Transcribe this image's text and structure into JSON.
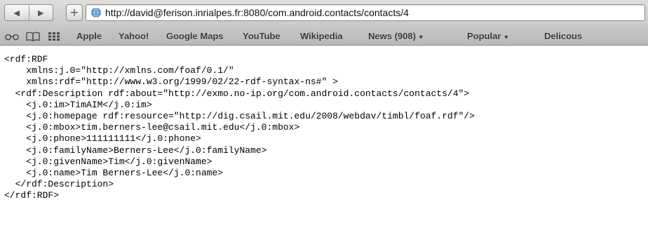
{
  "toolbar": {
    "back_label": "◀",
    "forward_label": "▶",
    "add_label": "+",
    "url": "http://david@ferison.inrialpes.fr:8080/com.android.contacts/contacts/4"
  },
  "bookmarks": {
    "items": [
      {
        "label": "Apple",
        "has_menu": false
      },
      {
        "label": "Yahoo!",
        "has_menu": false
      },
      {
        "label": "Google Maps",
        "has_menu": false
      },
      {
        "label": "YouTube",
        "has_menu": false
      },
      {
        "label": "Wikipedia",
        "has_menu": false
      },
      {
        "label": "News (908)",
        "has_menu": true
      },
      {
        "label": "Popular",
        "has_menu": true
      },
      {
        "label": "Delicous",
        "has_menu": false
      }
    ],
    "menu_chevron": "▼"
  },
  "document": {
    "lines": [
      "<rdf:RDF",
      "    xmlns:j.0=\"http://xmlns.com/foaf/0.1/\"",
      "    xmlns:rdf=\"http://www.w3.org/1999/02/22-rdf-syntax-ns#\" >",
      "  <rdf:Description rdf:about=\"http://exmo.no-ip.org/com.android.contacts/contacts/4\">",
      "    <j.0:im>TimAIM</j.0:im>",
      "    <j.0:homepage rdf:resource=\"http://dig.csail.mit.edu/2008/webdav/timbl/foaf.rdf\"/>",
      "    <j.0:mbox>tim.berners-lee@csail.mit.edu</j.0:mbox>",
      "    <j.0:phone>111111111</j.0:phone>",
      "    <j.0:familyName>Berners-Lee</j.0:familyName>",
      "    <j.0:givenName>Tim</j.0:givenName>",
      "    <j.0:name>Tim Berners-Lee</j.0:name>",
      "  </rdf:Description>",
      "</rdf:RDF>"
    ]
  },
  "colors": {
    "toolbar_top": "#dedede",
    "toolbar_bottom": "#c8c8c8",
    "bookmark_text": "#3a3a3a",
    "globe_blue": "#2f7fd6"
  }
}
